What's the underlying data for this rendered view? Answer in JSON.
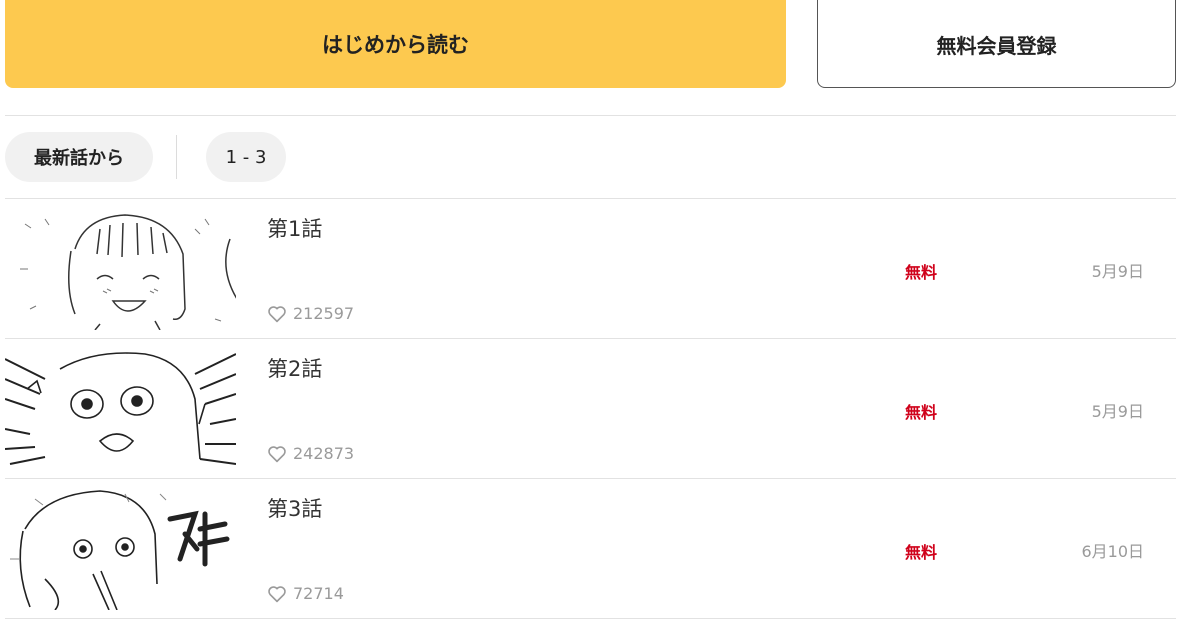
{
  "actions": {
    "read_from_start": "はじめから読む",
    "register_free": "無料会員登録"
  },
  "filter": {
    "latest_label": "最新話から",
    "range_label": "1 - 3"
  },
  "episodes": [
    {
      "title": "第1話",
      "likes": "212597",
      "badge": "無料",
      "date": "5月9日"
    },
    {
      "title": "第2話",
      "likes": "242873",
      "badge": "無料",
      "date": "5月9日"
    },
    {
      "title": "第3話",
      "likes": "72714",
      "badge": "無料",
      "date": "6月10日"
    }
  ],
  "colors": {
    "primary_button": "#fdc94f",
    "free_badge": "#d0021b",
    "muted_text": "#9a9a9a"
  },
  "icons": {
    "likes": "heart-outline-icon"
  }
}
